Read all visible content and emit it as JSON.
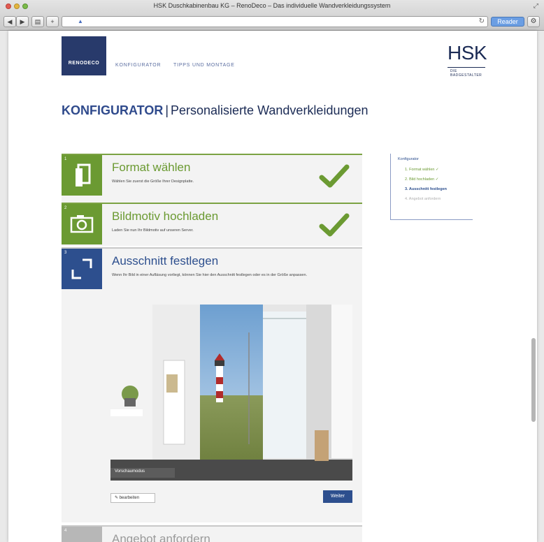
{
  "browser": {
    "window_title": "HSK Duschkabinenbau KG – RenoDeco – Das individuelle Wandverkleidungssystem",
    "reader_label": "Reader",
    "back_symbol": "◀",
    "forward_symbol": "▶",
    "tabs_symbol": "▤",
    "add_symbol": "+"
  },
  "header": {
    "logo_text": "RENODECO",
    "nav": [
      "KONFIGURATOR",
      "TIPPS UND MONTAGE"
    ],
    "brand": "HSK",
    "brand_sub": "DIE BADGESTALTER"
  },
  "page_title": {
    "strong": "KONFIGURATOR",
    "separator": "|",
    "rest": "Personalisierte Wandverkleidungen"
  },
  "steps": [
    {
      "number": "1",
      "title": "Format wählen",
      "description": "Wählen Sie zuerst die Größe Ihrer Designplatte.",
      "status": "done"
    },
    {
      "number": "2",
      "title": "Bildmotiv hochladen",
      "description": "Laden Sie nun Ihr Bildmotiv auf unseren Server.",
      "status": "done"
    },
    {
      "number": "3",
      "title": "Ausschnitt festlegen",
      "description": "Wenn Ihr Bild in einer Aufläsung vorliegt, können Sie hier den Ausschnitt festlegen oder es in der Größe anpassen.",
      "status": "active"
    },
    {
      "number": "4",
      "title": "Angebot anfordern",
      "status": "todo"
    }
  ],
  "step3": {
    "preview_label": "Vorschaumodus",
    "edit_label": "bearbeiten",
    "next_label": "Weiter"
  },
  "sidebar": {
    "title": "Konfigurator",
    "items": [
      {
        "label": "1. Format wählen",
        "status": "done"
      },
      {
        "label": "2. Bild hochladen",
        "status": "done"
      },
      {
        "label": "3. Ausschnitt festlegen",
        "status": "active"
      },
      {
        "label": "4. Angebot anfordern",
        "status": "todo"
      }
    ]
  },
  "colors": {
    "brand_blue": "#2d4f8e",
    "step_green": "#6b9a32",
    "logo_box": "#283a6b"
  }
}
